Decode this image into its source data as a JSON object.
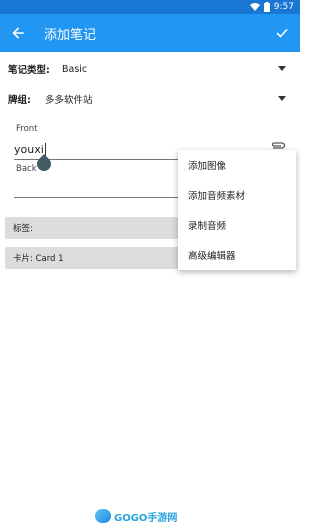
{
  "status_bar": {
    "time": "9:57"
  },
  "app_bar": {
    "title": "添加笔记",
    "back_icon": "arrow-back-icon",
    "confirm_icon": "check-icon"
  },
  "note_type": {
    "label": "笔记类型:",
    "value": "Basic"
  },
  "deck": {
    "label": "牌组:",
    "value": "多多软件站"
  },
  "fields": [
    {
      "label": "Front",
      "value": "youxi"
    },
    {
      "label": "Back",
      "value": ""
    }
  ],
  "tags_bar": {
    "label": "标签:"
  },
  "cards_bar": {
    "label": "卡片: Card 1"
  },
  "popup_menu": {
    "items": [
      "添加图像",
      "添加音频素材",
      "录制音频",
      "高级编辑器"
    ]
  },
  "watermark": {
    "text": "GOGO手游网"
  },
  "colors": {
    "status_bar": "#1976d2",
    "app_bar": "#2196f3",
    "bar_background": "#dcdcdc"
  }
}
